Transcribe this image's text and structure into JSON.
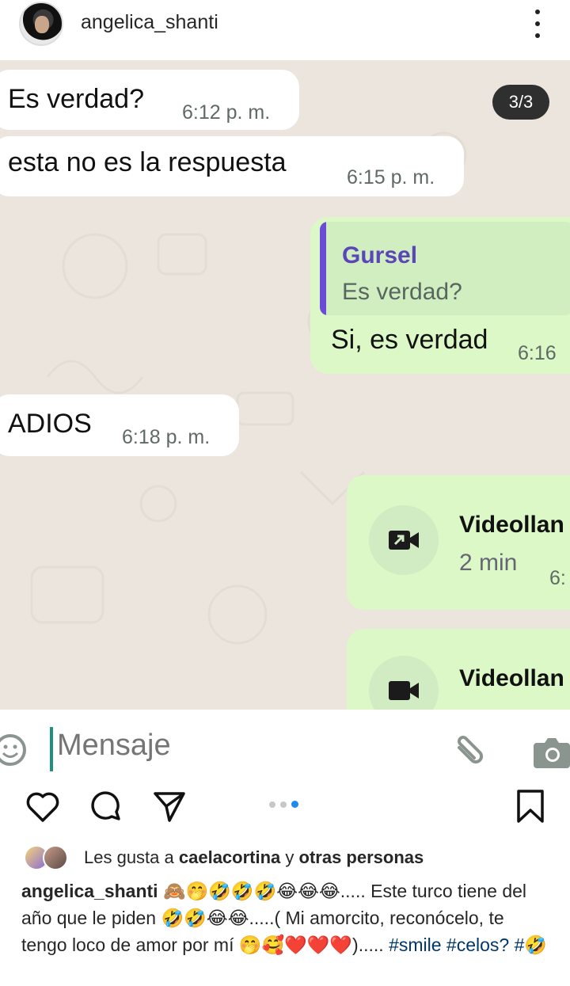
{
  "header": {
    "username": "angelica_shanti"
  },
  "chat": {
    "page_indicator": "3/3",
    "messages": [
      {
        "text": "Es verdad?",
        "time": "6:12 p. m."
      },
      {
        "text": "esta no es la respuesta",
        "time": "6:15 p. m."
      },
      {
        "quote_author": "Gursel",
        "quote_text": "Es verdad?",
        "text": "Si, es verdad",
        "time": "6:16"
      },
      {
        "text": "ADIOS",
        "time": "6:18 p. m."
      },
      {
        "call_title": "Videollan",
        "call_duration": "2 min",
        "time": "6:"
      },
      {
        "call_title": "Videollan"
      }
    ],
    "composer_placeholder": "Mensaje"
  },
  "post": {
    "likes_prefix": "Les gusta a ",
    "likes_user": "caelacortina",
    "likes_and": " y ",
    "likes_others": "otras personas",
    "caption_user": "angelica_shanti",
    "caption_text": " 🙈🤭🤣🤣🤣😂😂😂..... Este turco tiene del año que le piden 🤣🤣😂😂.....( Mi amorcito, reconócelo, te tengo loco de amor por mí 🤭🥰❤️❤️❤️).....",
    "hashtags": "#smile #celos? #🤣"
  },
  "colors": {
    "chat_bg": "#ece5dd",
    "outgoing_bubble": "#dcf8c6",
    "incoming_bubble": "#ffffff",
    "quote_accent": "#6b4bd6",
    "active_dot": "#1a8cf0"
  }
}
